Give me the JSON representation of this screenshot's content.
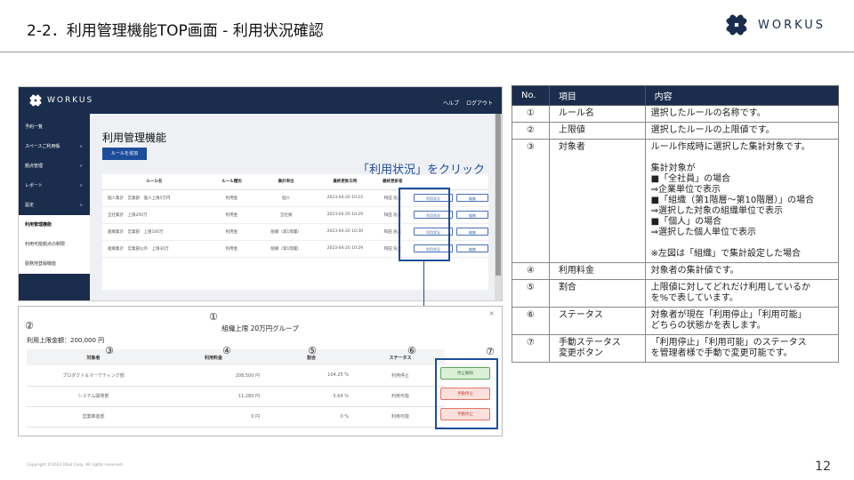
{
  "slide": {
    "title": "2-2．利用管理機能TOP画面 - 利用状況確認",
    "logo_text": "WORKUS",
    "page_number": "12",
    "copyright": "Copyright ©2022 Obol Corp. All rights reserved."
  },
  "app": {
    "logo_text": "WORKUS",
    "top_links": [
      "ヘルプ",
      "ログアウト"
    ],
    "sidebar": {
      "items": [
        "予約一覧",
        "スペースご利用帳",
        "拠点管理",
        "レポート",
        "設定"
      ],
      "sub_items": [
        "利用管理機能",
        "利用可能拠点の制限",
        "勤務地登録機能"
      ]
    },
    "main_title": "利用管理機能",
    "add_button": "ルールを追加",
    "table": {
      "headers": [
        "ルール名",
        "ルール種別",
        "集計単位",
        "最終更新日時",
        "最終更新者",
        "",
        ""
      ],
      "rows": [
        [
          "個人集計　営業部　個人上限5万円",
          "利用金",
          "個人",
          "2023-04-20 10:22",
          "和田 浩太",
          "利用状況",
          "編集"
        ],
        [
          "全社集計　上限200万",
          "利用金",
          "全社員",
          "2023-04-20 10:29",
          "和田 浩太",
          "利用状況",
          "編集"
        ],
        [
          "組織集計　営業部　上限100万",
          "利用金",
          "組織（第1階層）",
          "2023-04-20 10:30",
          "和田 浩太",
          "利用状況",
          "編集"
        ],
        [
          "組織集計　営業部以外　上限30万",
          "利用金",
          "組織（第1階層）",
          "2023-04-20 10:29",
          "和田 浩太",
          "利用状況",
          "編集"
        ]
      ]
    }
  },
  "callout": {
    "text": "「利用状況」をクリック"
  },
  "popup": {
    "close": "×",
    "title": "組織上限 20万円グループ",
    "limit": "利用上限金額：200,000 円",
    "headers": [
      "対象者",
      "利用料金",
      "割合",
      "ステータス"
    ],
    "rows": [
      {
        "target": "プロダクト＆マーケティング部",
        "fee": "208,500 円",
        "ratio": "104.25 %",
        "status": "利用停止",
        "button": "停止解除"
      },
      {
        "target": "システム開発部",
        "fee": "11,280 円",
        "ratio": "5.64 %",
        "status": "利用可能",
        "button": "手動停止"
      },
      {
        "target": "営業推進部",
        "fee": "0 円",
        "ratio": "0 %",
        "status": "利用可能",
        "button": "手動停止"
      }
    ]
  },
  "markers": [
    "①",
    "②",
    "③",
    "④",
    "⑤",
    "⑥",
    "⑦"
  ],
  "spec_table": {
    "headers": [
      "No.",
      "項目",
      "内容"
    ],
    "rows": [
      {
        "no": "①",
        "item": "ルール名",
        "desc": "選択したルールの名称です。"
      },
      {
        "no": "②",
        "item": "上限値",
        "desc": "選択したルールの上限値です。"
      },
      {
        "no": "③",
        "item": "対象者",
        "desc": "ルール作成時に選択した集計対象です。\n\n集計対象が\n■「全社員」の場合\n⇒企業単位で表示\n■「組織（第1階層～第10階層）」の場合\n⇒選択した対象の組織単位で表示\n■「個人」の場合\n⇒選択した個人単位で表示\n\n※左図は「組織」で集計設定した場合"
      },
      {
        "no": "④",
        "item": "利用料金",
        "desc": "対象者の集計値です。"
      },
      {
        "no": "⑤",
        "item": "割合",
        "desc": "上限値に対してどれだけ利用しているか\nを%で表しています。"
      },
      {
        "no": "⑥",
        "item": "ステータス",
        "desc": "対象者が現在「利用停止」「利用可能」\nどちらの状態かを表します。"
      },
      {
        "no": "⑦",
        "item": "手動ステータス\n変更ボタン",
        "desc": "「利用停止」「利用可能」のステータス\nを管理者様で手動で変更可能です。"
      }
    ]
  }
}
